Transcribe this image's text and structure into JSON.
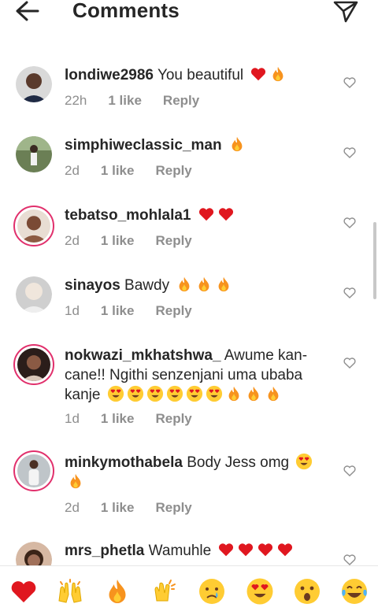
{
  "header": {
    "title": "Comments"
  },
  "comments": [
    {
      "username": "londiwe2986",
      "text": "You beautiful",
      "emojis": [
        "heart",
        "fire"
      ],
      "time": "22h",
      "likes": "1 like",
      "reply": "Reply"
    },
    {
      "username": "simphiweclassic_man",
      "text": "",
      "emojis": [
        "fire"
      ],
      "time": "2d",
      "likes": "1 like",
      "reply": "Reply"
    },
    {
      "username": "tebatso_mohlala1",
      "text": "",
      "emojis": [
        "heart",
        "heart"
      ],
      "time": "2d",
      "likes": "1 like",
      "reply": "Reply"
    },
    {
      "username": "sinayos",
      "text": "Bawdy",
      "emojis": [
        "fire",
        "fire",
        "fire"
      ],
      "time": "1d",
      "likes": "1 like",
      "reply": "Reply"
    },
    {
      "username": "nokwazi_mkhatshwa_",
      "text": "Awume kan-cane!! Ngithi senzenjani uma ubaba kanje",
      "emojis": [
        "heart-eyes",
        "heart-eyes",
        "heart-eyes",
        "heart-eyes",
        "heart-eyes",
        "heart-eyes",
        "fire",
        "fire",
        "fire"
      ],
      "time": "1d",
      "likes": "1 like",
      "reply": "Reply"
    },
    {
      "username": "minkymothabela",
      "text": "Body Jess omg",
      "emojis": [
        "heart-eyes",
        "fire"
      ],
      "time": "2d",
      "likes": "1 like",
      "reply": "Reply"
    },
    {
      "username": "mrs_phetla",
      "text": "Wamuhle",
      "emojis": [
        "heart",
        "heart",
        "heart",
        "heart"
      ],
      "time": "",
      "likes": "",
      "reply": ""
    }
  ],
  "emoji_bar": [
    "red-heart",
    "raising-hands",
    "fire",
    "clapping-hands",
    "crying-face",
    "heart-eyes",
    "astonished-face",
    "tears-of-joy"
  ],
  "colors": {
    "text": "#262626",
    "secondary": "#8e8e8e",
    "story_ring": "#e1306c",
    "heart_red": "#e0171f",
    "fire_orange": "#f7931e"
  }
}
